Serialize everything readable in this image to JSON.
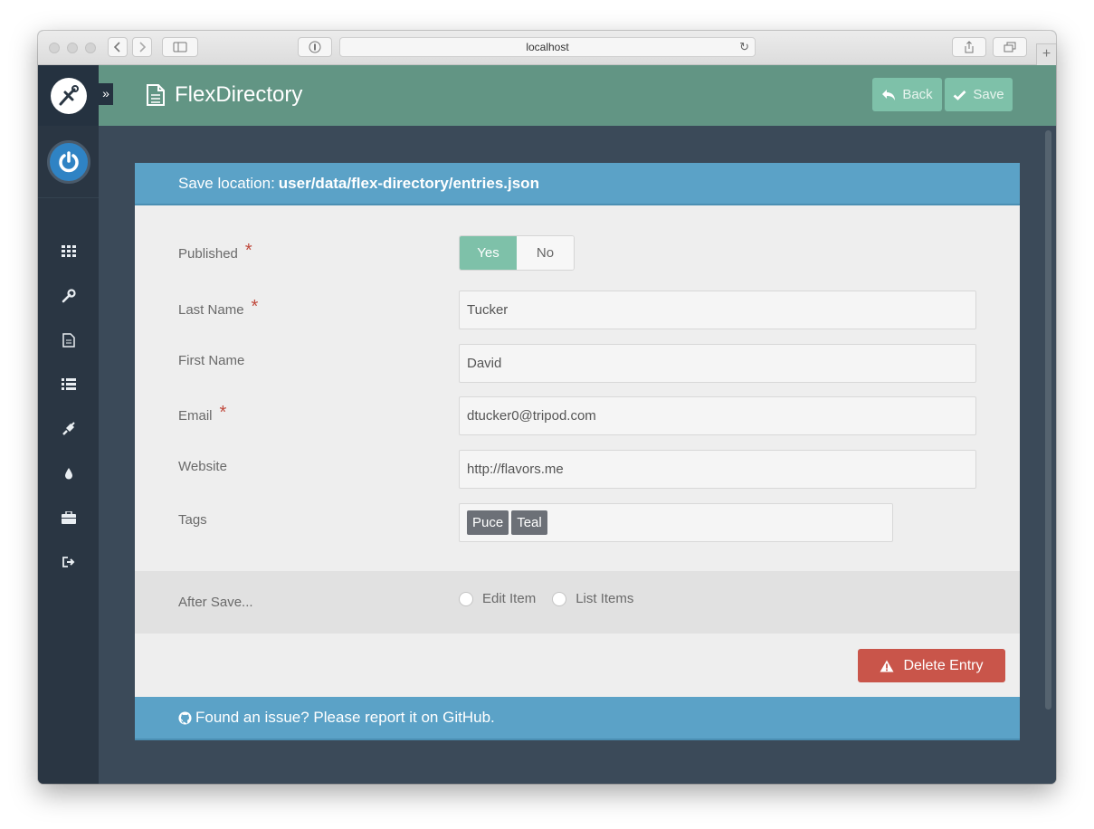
{
  "browser": {
    "url": "localhost"
  },
  "app": {
    "title": "FlexDirectory",
    "back_label": "Back",
    "save_label": "Save",
    "accent_color": "#629584",
    "button_color": "#7ec1a9"
  },
  "sidebar": {
    "items": [
      {
        "icon": "grid-icon"
      },
      {
        "icon": "wrench-icon"
      },
      {
        "icon": "page-icon"
      },
      {
        "icon": "list-icon"
      },
      {
        "icon": "plug-icon"
      },
      {
        "icon": "drop-icon"
      },
      {
        "icon": "briefcase-icon"
      },
      {
        "icon": "sign-out-icon"
      }
    ]
  },
  "card": {
    "save_location_label": "Save location:",
    "save_location_path": "user/data/flex-directory/entries.json",
    "fields": {
      "published": {
        "label": "Published",
        "required": "*",
        "yes": "Yes",
        "no": "No",
        "selected": "Yes"
      },
      "last_name": {
        "label": "Last Name",
        "required": "*",
        "value": "Tucker"
      },
      "first_name": {
        "label": "First Name",
        "value": "David"
      },
      "email": {
        "label": "Email",
        "required": "*",
        "value": "dtucker0@tripod.com"
      },
      "website": {
        "label": "Website",
        "value": "http://flavors.me"
      },
      "tags": {
        "label": "Tags",
        "values": [
          "Puce",
          "Teal"
        ]
      }
    },
    "after_save": {
      "label": "After Save...",
      "options": [
        "Edit Item",
        "List Items"
      ]
    },
    "delete_label": "Delete Entry",
    "footer_text": "Found an issue? Please report it on GitHub."
  }
}
